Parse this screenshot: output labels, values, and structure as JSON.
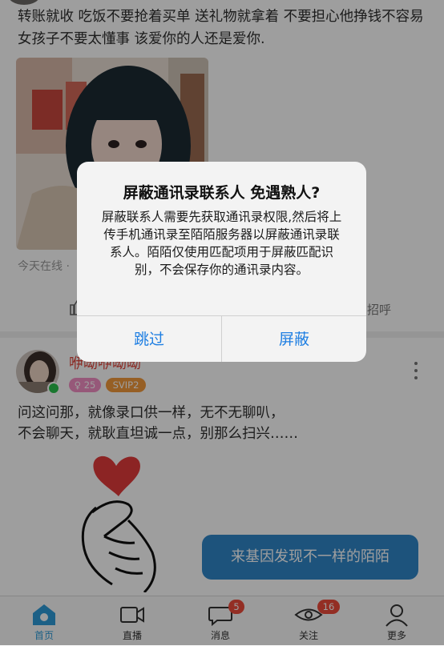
{
  "post1": {
    "text": "转账就收 吃饭不要抢着买单 送礼物就拿着 不要担心他挣钱不容易 女孩子不要太懂事 该爱你的人还是爱你.",
    "meta_partial": "今天在线 ·",
    "greet_partial": "招呼"
  },
  "post2": {
    "username_partial": "咿呦咿呦呦",
    "age_badge": "25",
    "vip_badge": "SVIP2",
    "text": "问这问那，就像录口供一样，无不无聊叭，\n不会聊天，就耿直坦诚一点，别那么扫兴……"
  },
  "bubble": {
    "text": "来基因发现不一样的陌陌"
  },
  "tabs": [
    {
      "label": "首页",
      "icon": "home-icon",
      "active": true
    },
    {
      "label": "直播",
      "icon": "live-video-icon"
    },
    {
      "label": "消息",
      "icon": "message-bubble-icon",
      "badge": "5"
    },
    {
      "label": "关注",
      "icon": "eye-icon",
      "badge": "16"
    },
    {
      "label": "更多",
      "icon": "person-icon"
    }
  ],
  "dialog": {
    "title": "屏蔽通讯录联系人 免遇熟人?",
    "body": "屏蔽联系人需要先获取通讯录权限,然后将上传手机通讯录至陌陌服务器以屏蔽通讯录联系人。陌陌仅使用匹配项用于屏蔽匹配识别，不会保存你的通讯录内容。",
    "skip_label": "跳过",
    "block_label": "屏蔽"
  },
  "colors": {
    "accent": "#2e9cd9",
    "dialog_button": "#1f7fe2",
    "badge": "#ee4b3a",
    "username": "#e0443a"
  }
}
